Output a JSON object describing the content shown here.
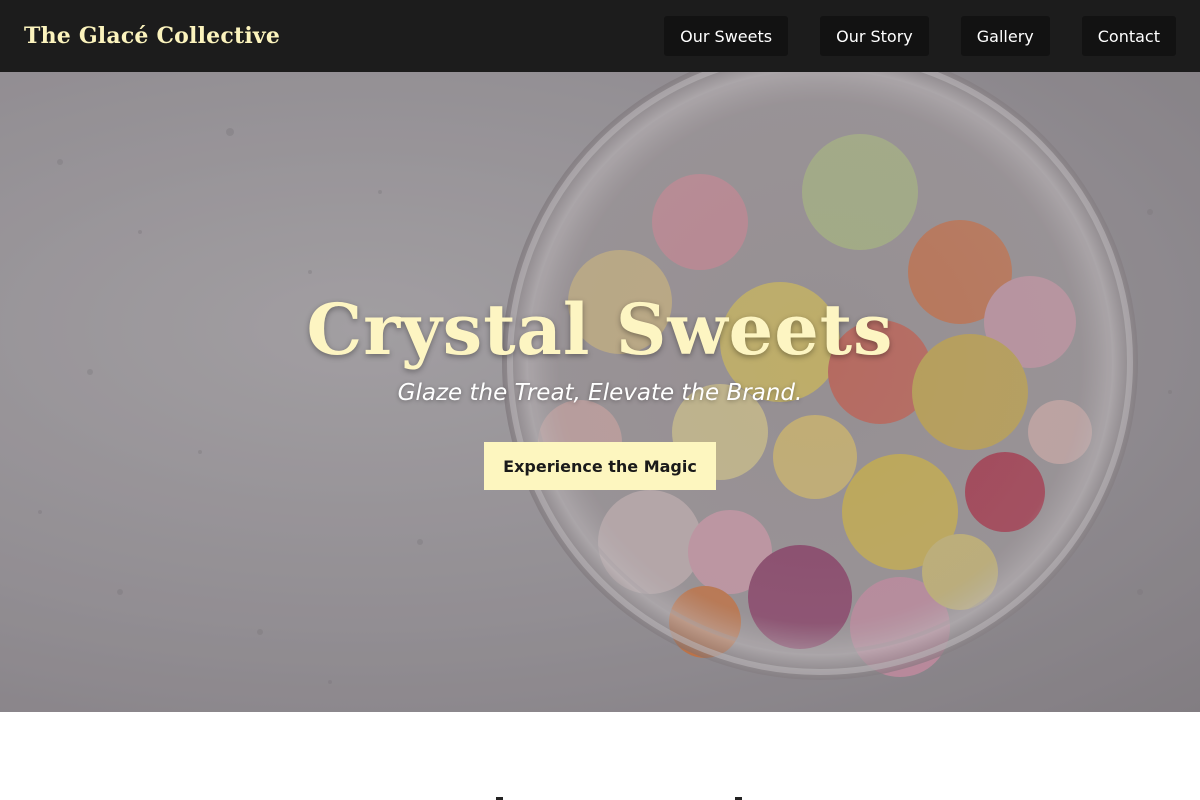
{
  "brand": {
    "name": "The Glacé Collective"
  },
  "nav": {
    "items": [
      {
        "label": "Our Sweets"
      },
      {
        "label": "Our Story"
      },
      {
        "label": "Gallery"
      },
      {
        "label": "Contact"
      }
    ]
  },
  "hero": {
    "title": "Crystal Sweets",
    "subtitle": "Glaze the Treat, Elevate the Brand.",
    "cta_label": "Experience the Magic",
    "image_subject": "glass jar of sugar-coated candies"
  },
  "colors": {
    "nav_background": "#1c1c1c",
    "nav_button": "#121212",
    "brand_text": "#fbf3bd",
    "accent_cream": "#fdf6bf"
  }
}
